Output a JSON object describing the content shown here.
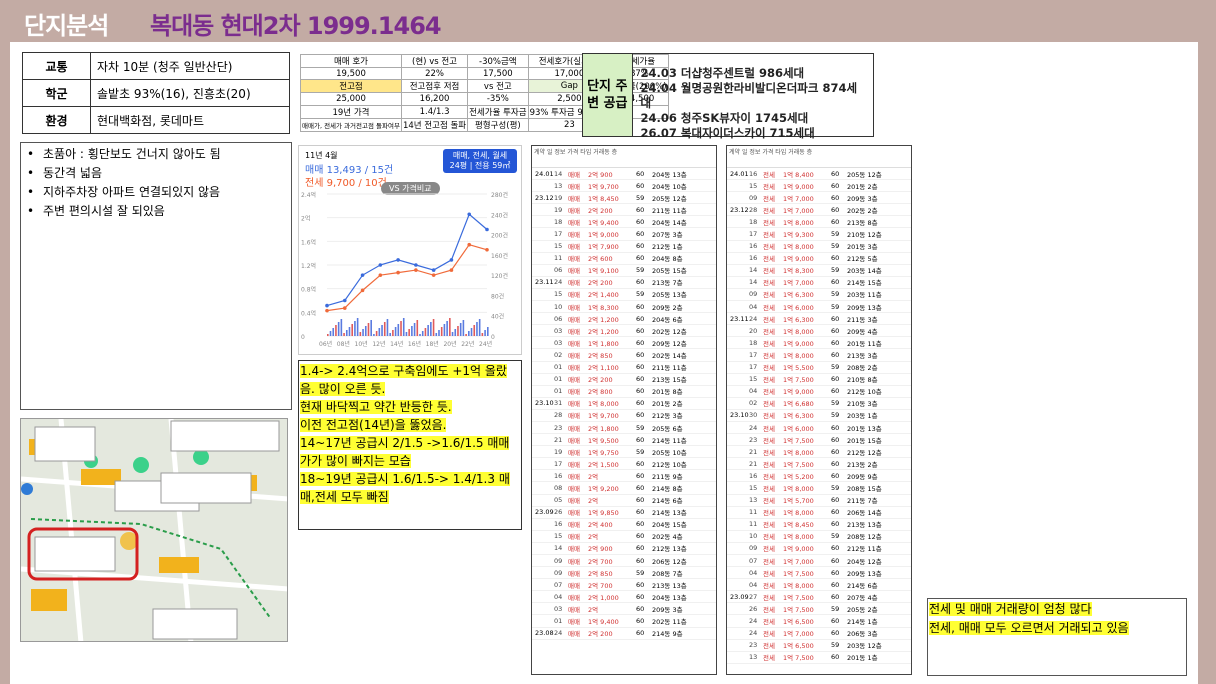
{
  "header": {
    "title": "단지분석",
    "subtitle": "복대동 현대2차  1999.1464"
  },
  "info": [
    {
      "k": "교통",
      "v": "자차 10분 (청주 일반산단)"
    },
    {
      "k": "학군",
      "v": "솔밭초 93%(16), 진흥초(20)"
    },
    {
      "k": "환경",
      "v": "현대백화점, 롯데마트"
    }
  ],
  "bullets": [
    "초품아 : 횡단보도 건너지 않아도 됨",
    "동간격 넓음",
    "지하주차장 아파트 연결되있지 않음",
    "주변 편의시설 잘 되있음"
  ],
  "mini": {
    "r1": [
      "매매 호가",
      "(현) vs 전고",
      "-30%금액",
      "전세호가(실거래)",
      "전세가율"
    ],
    "r2": [
      "19,500",
      "22%",
      "17,500",
      "17,000",
      "87%"
    ],
    "r3": [
      "전고점",
      "전고점후 저점",
      "vs 전고",
      "Gap",
      "수익률(200%)"
    ],
    "r4": [
      "25,000",
      "16,200",
      "-35%",
      "2,500",
      "24,500"
    ],
    "r5": [
      "19년 가격",
      "1.4/1.3",
      "전세가율 투자금",
      "93% 투자금 995만원",
      ""
    ],
    "r6": [
      "매매가, 전세가 과거전고점 돌파여부",
      "14년 전고점 돌파",
      "평형구성(평)",
      "23"
    ]
  },
  "supply": {
    "label": "단지 주변 공급",
    "items": [
      "24.03 더샵청주센트럴 986세대",
      "24.04 월명공원한라비발디온더파크 874세대",
      "24.06  청주SK뷰자이 1745세대",
      "26.07 복대자이더스카이 715세대"
    ]
  },
  "chart": {
    "ym": "11년 4월",
    "sale": "매매 13,493 / 15건",
    "jeonse": "전세 9,700 / 10건",
    "select": "매매, 전세, 월세",
    "select2": "24평 | 전용 59㎡",
    "vs": "VS 가격비교",
    "yleft": [
      "2.4억",
      "2억",
      "1.6억",
      "1.2억",
      "0.8억",
      "0.4억",
      "0"
    ],
    "yright": [
      "280건",
      "240건",
      "200건",
      "160건",
      "120건",
      "80건",
      "40건",
      "0"
    ],
    "xlabels": [
      "06년",
      "08년",
      "10년",
      "12년",
      "14년",
      "16년",
      "18년",
      "20년",
      "22년",
      "24년"
    ]
  },
  "chart_data": {
    "type": "line",
    "x": [
      "06년",
      "08년",
      "10년",
      "12년",
      "14년",
      "16년",
      "18년",
      "20년",
      "22년",
      "24년"
    ],
    "series": [
      {
        "name": "매매",
        "values": [
          0.6,
          0.7,
          1.2,
          1.4,
          1.5,
          1.4,
          1.3,
          1.5,
          2.4,
          2.1
        ]
      },
      {
        "name": "전세",
        "values": [
          0.5,
          0.55,
          0.9,
          1.2,
          1.25,
          1.3,
          1.2,
          1.3,
          1.8,
          1.7
        ]
      }
    ],
    "ylim": [
      0,
      2.8
    ]
  },
  "notes": [
    "1.4-> 2.4억으로 구축임에도 +1억 올랐음. 많이 오른 듯.",
    "현재 바닥찍고 약간 반등한 듯.",
    "이전 전고점(14년)을 뚫었음.",
    "14~17년 공급시 2/1.5 ->1.6/1.5 매매가가 많이 빠지는 모습",
    "18~19년 공급시 1.6/1.5-> 1.4/1.3 매매,전세 모두 빠짐"
  ],
  "list1": [
    [
      "24.01",
      "14",
      "매매",
      "2억 900",
      "60",
      "204동 13층"
    ],
    [
      "",
      "13",
      "매매",
      "1억 9,700",
      "60",
      "204동 10층"
    ],
    [
      "23.12",
      "19",
      "매매",
      "1억 8,450",
      "59",
      "205동 12층"
    ],
    [
      "",
      "19",
      "매매",
      "2억 200",
      "60",
      "211동 11층"
    ],
    [
      "",
      "18",
      "매매",
      "1억 9,400",
      "60",
      "204동 14층"
    ],
    [
      "",
      "17",
      "매매",
      "1억 9,000",
      "60",
      "207동 3층"
    ],
    [
      "",
      "15",
      "매매",
      "1억 7,900",
      "60",
      "212동 1층"
    ],
    [
      "",
      "11",
      "매매",
      "2억 600",
      "60",
      "204동 8층"
    ],
    [
      "",
      "06",
      "매매",
      "1억 9,100",
      "59",
      "205동 15층"
    ],
    [
      "23.11",
      "24",
      "매매",
      "2억 200",
      "60",
      "213동 7층"
    ],
    [
      "",
      "15",
      "매매",
      "2억 1,400",
      "59",
      "205동 13층"
    ],
    [
      "",
      "10",
      "매매",
      "1억 8,300",
      "60",
      "209동 2층"
    ],
    [
      "",
      "06",
      "매매",
      "2억 1,200",
      "60",
      "204동 6층"
    ],
    [
      "",
      "03",
      "매매",
      "2억 1,200",
      "60",
      "202동 12층"
    ],
    [
      "",
      "03",
      "매매",
      "1억 1,800",
      "60",
      "209동 12층"
    ],
    [
      "",
      "02",
      "매매",
      "2억 850",
      "60",
      "202동 14층"
    ],
    [
      "",
      "01",
      "매매",
      "2억 1,100",
      "60",
      "211동 11층"
    ],
    [
      "",
      "01",
      "매매",
      "2억 200",
      "60",
      "213동 15층"
    ],
    [
      "",
      "01",
      "매매",
      "2억 800",
      "60",
      "201동 8층"
    ],
    [
      "23.10",
      "31",
      "매매",
      "1억 8,000",
      "60",
      "201동 2층"
    ],
    [
      "",
      "28",
      "매매",
      "1억 9,700",
      "60",
      "212동 3층"
    ],
    [
      "",
      "23",
      "매매",
      "2억 1,800",
      "59",
      "205동 6층"
    ],
    [
      "",
      "21",
      "매매",
      "1억 9,500",
      "60",
      "214동 11층"
    ],
    [
      "",
      "19",
      "매매",
      "1억 9,750",
      "59",
      "205동 10층"
    ],
    [
      "",
      "17",
      "매매",
      "2억 1,500",
      "60",
      "212동 10층"
    ],
    [
      "",
      "16",
      "매매",
      "2억",
      "60",
      "211동 9층"
    ],
    [
      "",
      "08",
      "매매",
      "1억 9,200",
      "60",
      "214동 8층"
    ],
    [
      "",
      "05",
      "매매",
      "2억",
      "60",
      "214동 6층"
    ],
    [
      "23.09",
      "26",
      "매매",
      "1억 9,850",
      "60",
      "214동 13층"
    ],
    [
      "",
      "16",
      "매매",
      "2억 400",
      "60",
      "204동 15층"
    ],
    [
      "",
      "15",
      "매매",
      "2억",
      "60",
      "202동 4층"
    ],
    [
      "",
      "14",
      "매매",
      "2억 900",
      "60",
      "212동 13층"
    ],
    [
      "",
      "09",
      "매매",
      "2억 700",
      "60",
      "206동 12층"
    ],
    [
      "",
      "09",
      "매매",
      "2억 850",
      "59",
      "208동 7층"
    ],
    [
      "",
      "07",
      "매매",
      "2억 700",
      "60",
      "213동 13층"
    ],
    [
      "",
      "04",
      "매매",
      "2억 1,000",
      "60",
      "204동 13층"
    ],
    [
      "",
      "03",
      "매매",
      "2억",
      "60",
      "209동 3층"
    ],
    [
      "",
      "01",
      "매매",
      "1억 9,400",
      "60",
      "202동 11층"
    ],
    [
      "23.08",
      "24",
      "매매",
      "2억 200",
      "60",
      "214동 9층"
    ]
  ],
  "list2": [
    [
      "24.01",
      "16",
      "전세",
      "1억 8,400",
      "60",
      "205동 12층"
    ],
    [
      "",
      "15",
      "전세",
      "1억 9,000",
      "60",
      "201동 2층"
    ],
    [
      "",
      "09",
      "전세",
      "1억 7,000",
      "60",
      "209동 3층"
    ],
    [
      "23.12",
      "28",
      "전세",
      "1억 7,000",
      "60",
      "202동 2층"
    ],
    [
      "",
      "18",
      "전세",
      "1억 8,000",
      "60",
      "213동 8층"
    ],
    [
      "",
      "17",
      "전세",
      "1억 9,300",
      "59",
      "210동 12층"
    ],
    [
      "",
      "16",
      "전세",
      "1억 8,000",
      "59",
      "201동 3층"
    ],
    [
      "",
      "16",
      "전세",
      "1억 9,000",
      "60",
      "212동 5층"
    ],
    [
      "",
      "14",
      "전세",
      "1억 8,300",
      "59",
      "203동 14층"
    ],
    [
      "",
      "14",
      "전세",
      "1억 7,000",
      "60",
      "214동 15층"
    ],
    [
      "",
      "09",
      "전세",
      "1억 6,300",
      "59",
      "203동 11층"
    ],
    [
      "",
      "04",
      "전세",
      "1억 6,000",
      "59",
      "209동 13층"
    ],
    [
      "23.11",
      "24",
      "전세",
      "1억 6,300",
      "60",
      "211동 3층"
    ],
    [
      "",
      "20",
      "전세",
      "1억 8,000",
      "60",
      "209동 4층"
    ],
    [
      "",
      "18",
      "전세",
      "1억 9,000",
      "60",
      "201동 11층"
    ],
    [
      "",
      "17",
      "전세",
      "1억 8,000",
      "60",
      "213동 3층"
    ],
    [
      "",
      "17",
      "전세",
      "1억 5,500",
      "59",
      "208동 2층"
    ],
    [
      "",
      "15",
      "전세",
      "1억 7,500",
      "60",
      "210동 8층"
    ],
    [
      "",
      "04",
      "전세",
      "1억 9,000",
      "60",
      "212동 10층"
    ],
    [
      "",
      "02",
      "전세",
      "1억 6,680",
      "59",
      "210동 3층"
    ],
    [
      "23.10",
      "30",
      "전세",
      "1억 6,300",
      "59",
      "203동 1층"
    ],
    [
      "",
      "24",
      "전세",
      "1억 6,000",
      "60",
      "201동 13층"
    ],
    [
      "",
      "23",
      "전세",
      "1억 7,500",
      "60",
      "201동 15층"
    ],
    [
      "",
      "21",
      "전세",
      "1억 8,000",
      "60",
      "212동 12층"
    ],
    [
      "",
      "21",
      "전세",
      "1억 7,500",
      "60",
      "213동 2층"
    ],
    [
      "",
      "16",
      "전세",
      "1억 5,200",
      "60",
      "209동 9층"
    ],
    [
      "",
      "15",
      "전세",
      "1억 8,000",
      "59",
      "208동 15층"
    ],
    [
      "",
      "13",
      "전세",
      "1억 5,700",
      "60",
      "211동 7층"
    ],
    [
      "",
      "11",
      "전세",
      "1억 8,000",
      "60",
      "206동 14층"
    ],
    [
      "",
      "11",
      "전세",
      "1억 8,450",
      "60",
      "213동 13층"
    ],
    [
      "",
      "10",
      "전세",
      "1억 8,000",
      "59",
      "208동 12층"
    ],
    [
      "",
      "09",
      "전세",
      "1억 9,000",
      "60",
      "212동 11층"
    ],
    [
      "",
      "07",
      "전세",
      "1억 7,000",
      "60",
      "204동 12층"
    ],
    [
      "",
      "04",
      "전세",
      "1억 7,500",
      "60",
      "209동 13층"
    ],
    [
      "",
      "04",
      "전세",
      "1억 8,000",
      "60",
      "214동 6층"
    ],
    [
      "23.09",
      "27",
      "전세",
      "1억 7,500",
      "60",
      "207동 4층"
    ],
    [
      "",
      "26",
      "전세",
      "1억 7,500",
      "59",
      "205동 2층"
    ],
    [
      "",
      "24",
      "전세",
      "1억 6,500",
      "60",
      "214동 1층"
    ],
    [
      "",
      "24",
      "전세",
      "1억 7,000",
      "60",
      "206동 3층"
    ],
    [
      "",
      "23",
      "전세",
      "1억 6,500",
      "59",
      "203동 12층"
    ],
    [
      "",
      "13",
      "전세",
      "1억 7,500",
      "60",
      "201동 1층"
    ]
  ],
  "listhead": [
    "계약",
    "일",
    "정보",
    "가격",
    "타입",
    "거래동",
    "층"
  ],
  "bottom": [
    "전세 및 매매 거래량이 엄청 많다",
    "전세, 매매 모두 오르면서 거래되고 있음"
  ]
}
